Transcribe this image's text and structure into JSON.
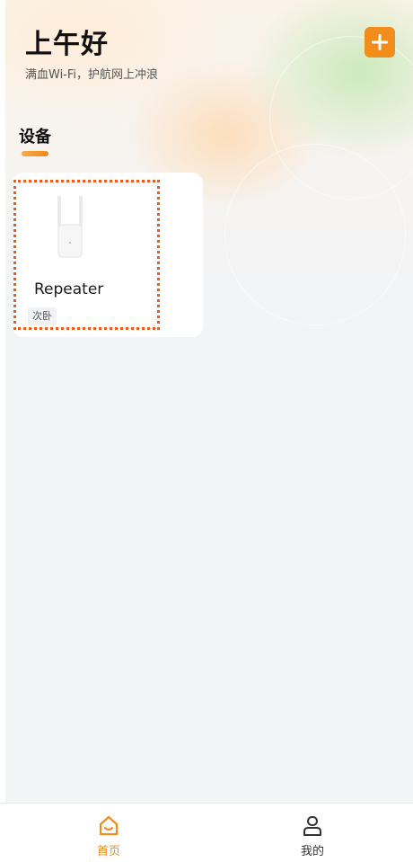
{
  "header": {
    "greeting": "上午好",
    "subtitle": "满血Wi-Fi，护航网上冲浪",
    "add_icon": "plus-icon"
  },
  "section": {
    "title": "设备"
  },
  "devices": [
    {
      "name": "Repeater",
      "room": "次卧",
      "icon": "wifi-repeater-image"
    }
  ],
  "tabbar": {
    "tabs": [
      {
        "label": "首页",
        "icon": "home-icon",
        "active": true
      },
      {
        "label": "我的",
        "icon": "user-icon",
        "active": false
      }
    ]
  },
  "colors": {
    "accent": "#f28c1b",
    "highlight": "#ef5a1f",
    "background": "#f3f4f6"
  }
}
